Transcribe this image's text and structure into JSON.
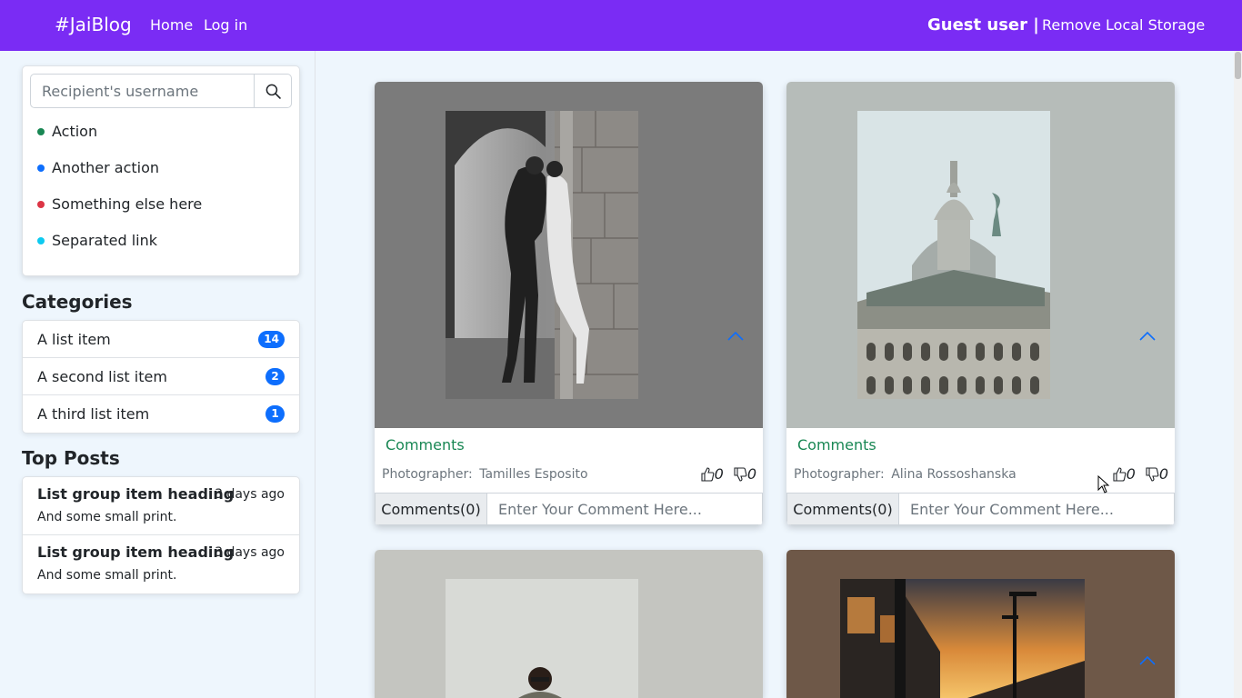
{
  "navbar": {
    "brand": "#JaiBlog",
    "links": [
      "Home",
      "Log in"
    ],
    "user": "Guest user |",
    "remove": "Remove Local Storage",
    "color": "#7a2cf4"
  },
  "sidebar": {
    "search_placeholder": "Recipient's username",
    "actions": [
      {
        "label": "Action",
        "color": "#198754"
      },
      {
        "label": "Another action",
        "color": "#0d6efd"
      },
      {
        "label": "Something else here",
        "color": "#dc3545"
      },
      {
        "label": "Separated link",
        "color": "#0dcaf0"
      }
    ],
    "categories_title": "Categories",
    "categories": [
      {
        "label": "A list item",
        "count": "14"
      },
      {
        "label": "A second list item",
        "count": "2"
      },
      {
        "label": "A third list item",
        "count": "1"
      }
    ],
    "top_posts_title": "Top Posts",
    "top_posts": [
      {
        "heading": "List group item heading",
        "time": "3 days ago",
        "small": "And some small print."
      },
      {
        "heading": "List group item heading",
        "time": "3 days ago",
        "small": "And some small print."
      }
    ]
  },
  "posts": [
    {
      "comments_label": "Comments",
      "photographer_label": "Photographer:",
      "photographer": "Tamilles Esposito",
      "likes": "0",
      "dislikes": "0",
      "comment_button": "Comments(0)",
      "comment_placeholder": "Enter Your Comment Here...",
      "bg": "#7b7b7b"
    },
    {
      "comments_label": "Comments",
      "photographer_label": "Photographer:",
      "photographer": "Alina Rossoshanska",
      "likes": "0",
      "dislikes": "0",
      "comment_button": "Comments(0)",
      "comment_placeholder": "Enter Your Comment Here...",
      "bg": "#b6bcb9"
    },
    {
      "bg": "#c4c5c0"
    },
    {
      "bg": "#6e5848"
    }
  ]
}
